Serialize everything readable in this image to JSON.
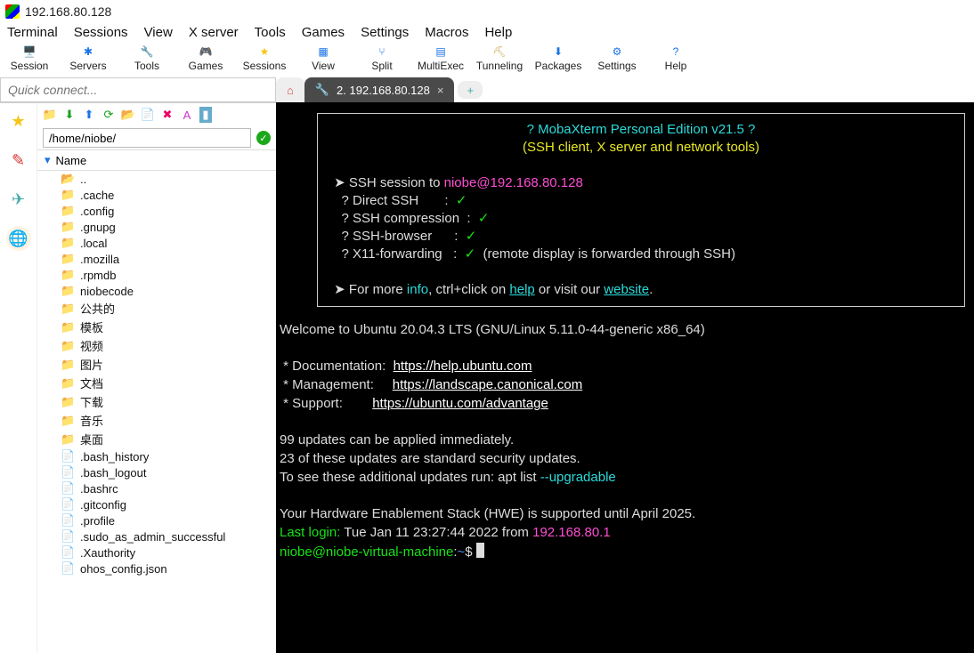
{
  "title": "192.168.80.128",
  "menu": [
    "Terminal",
    "Sessions",
    "View",
    "X server",
    "Tools",
    "Games",
    "Settings",
    "Macros",
    "Help"
  ],
  "toolbar": [
    {
      "label": "Session",
      "icon": "🖥️",
      "color": "#18a018"
    },
    {
      "label": "Servers",
      "icon": "✱",
      "color": "#1a73e8"
    },
    {
      "label": "Tools",
      "icon": "🔧",
      "color": "#d33"
    },
    {
      "label": "Games",
      "icon": "🎮",
      "color": "#555"
    },
    {
      "label": "Sessions",
      "icon": "★",
      "color": "#f5c518"
    },
    {
      "label": "View",
      "icon": "▦",
      "color": "#1a73e8"
    },
    {
      "label": "Split",
      "icon": "⑂",
      "color": "#1a73e8"
    },
    {
      "label": "MultiExec",
      "icon": "▤",
      "color": "#1a73e8"
    },
    {
      "label": "Tunneling",
      "icon": "⛏",
      "color": "#caa94a"
    },
    {
      "label": "Packages",
      "icon": "⬇",
      "color": "#1a73e8"
    },
    {
      "label": "Settings",
      "icon": "⚙",
      "color": "#1a73e8"
    },
    {
      "label": "Help",
      "icon": "?",
      "color": "#1a73e8"
    }
  ],
  "quick_placeholder": "Quick connect...",
  "sftp": {
    "path": "/home/niobe/",
    "name_hdr": "Name",
    "items": [
      {
        "icon": "📂",
        "name": "..",
        "color": "#19a319"
      },
      {
        "icon": "📁",
        "name": ".cache",
        "color": "#f7d774"
      },
      {
        "icon": "📁",
        "name": ".config",
        "color": "#f7d774"
      },
      {
        "icon": "📁",
        "name": ".gnupg",
        "color": "#f7d774"
      },
      {
        "icon": "📁",
        "name": ".local",
        "color": "#f7d774"
      },
      {
        "icon": "📁",
        "name": ".mozilla",
        "color": "#f7d774"
      },
      {
        "icon": "📁",
        "name": ".rpmdb",
        "color": "#f7d774"
      },
      {
        "icon": "📁",
        "name": "niobecode",
        "color": "#f5b100"
      },
      {
        "icon": "📁",
        "name": "公共的",
        "color": "#f5b100"
      },
      {
        "icon": "📁",
        "name": "模板",
        "color": "#f5b100"
      },
      {
        "icon": "📁",
        "name": "视频",
        "color": "#f5b100"
      },
      {
        "icon": "📁",
        "name": "图片",
        "color": "#f5b100"
      },
      {
        "icon": "📁",
        "name": "文档",
        "color": "#f5b100"
      },
      {
        "icon": "📁",
        "name": "下载",
        "color": "#f5b100"
      },
      {
        "icon": "📁",
        "name": "音乐",
        "color": "#f5b100"
      },
      {
        "icon": "📁",
        "name": "桌面",
        "color": "#f5b100"
      },
      {
        "icon": "📄",
        "name": ".bash_history",
        "color": "#bbb"
      },
      {
        "icon": "📄",
        "name": ".bash_logout",
        "color": "#bbb"
      },
      {
        "icon": "📄",
        "name": ".bashrc",
        "color": "#bbb"
      },
      {
        "icon": "📄",
        "name": ".gitconfig",
        "color": "#ddd"
      },
      {
        "icon": "📄",
        "name": ".profile",
        "color": "#ddd"
      },
      {
        "icon": "📄",
        "name": ".sudo_as_admin_successful",
        "color": "#ddd"
      },
      {
        "icon": "📄",
        "name": ".Xauthority",
        "color": "#ddd"
      },
      {
        "icon": "📄",
        "name": "ohos_config.json",
        "color": "#bbb"
      }
    ]
  },
  "tabs": {
    "active_label": "2. 192.168.80.128"
  },
  "term": {
    "banner_title": "? MobaXterm Personal Edition v21.5 ?",
    "banner_sub": "(SSH client, X server and network tools)",
    "sess_prefix": "SSH session to ",
    "sess_target": "niobe@192.168.80.128",
    "rows": [
      "? Direct SSH       :  ",
      "? SSH compression  :  ",
      "? SSH-browser      :  ",
      "? X11-forwarding   :  "
    ],
    "x11_note": "  (remote display is forwarded through SSH)",
    "more1": "For more ",
    "info": "info",
    "more2": ", ctrl+click on ",
    "help": "help",
    "more3": " or visit our ",
    "website": "website",
    "welcome": "Welcome to Ubuntu 20.04.3 LTS (GNU/Linux 5.11.0-44-generic x86_64)",
    "doc_l": " * Documentation:  ",
    "doc_u": "https://help.ubuntu.com",
    "mgt_l": " * Management:     ",
    "mgt_u": "https://landscape.canonical.com",
    "sup_l": " * Support:        ",
    "sup_u": "https://ubuntu.com/advantage",
    "upd1": "99 updates can be applied immediately.",
    "upd2": "23 of these updates are standard security updates.",
    "upd3a": "To see these additional updates run: apt list ",
    "upd3b": "--upgradable",
    "hwe": "Your Hardware Enablement Stack (HWE) is supported until April 2025.",
    "last_a": "Last login:",
    "last_b": " Tue Jan 11 23:27:44 2022 from ",
    "last_ip": "192.168.80.1",
    "prompt": "niobe@niobe-virtual-machine",
    "prompt2": ":",
    "prompt3": "~",
    "prompt4": "$ "
  }
}
